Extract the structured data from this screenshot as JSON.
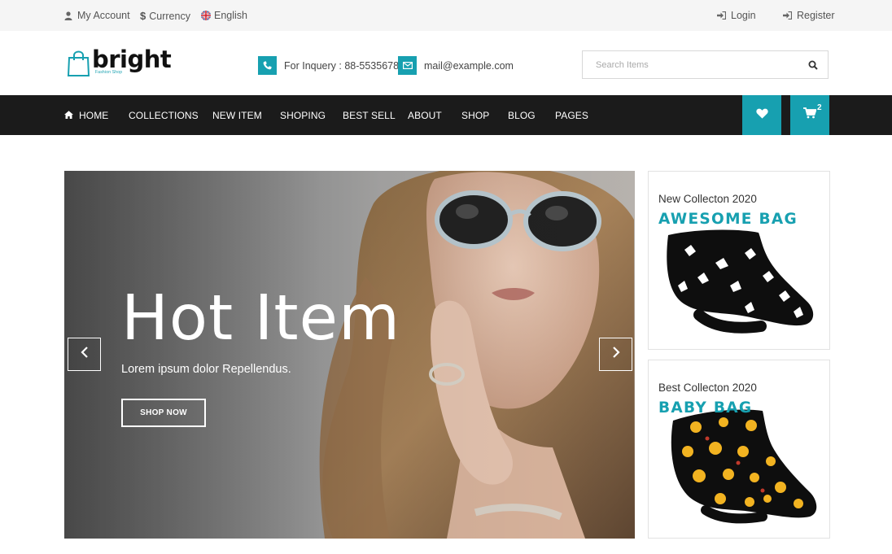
{
  "topbar": {
    "account": "My Account",
    "currency": "Currency",
    "language": "English",
    "login": "Login",
    "register": "Register"
  },
  "logo": {
    "word": "bright",
    "tagline": "Fashion Shop"
  },
  "contact": {
    "phone": "For Inquery : 88-5535678",
    "email": "mail@example.com"
  },
  "search": {
    "placeholder": "Search Items"
  },
  "nav": {
    "items": [
      "HOME",
      "COLLECTIONS",
      "NEW ITEM",
      "SHOPING",
      "BEST SELL",
      "ABOUT",
      "SHOP",
      "BLOG",
      "PAGES"
    ],
    "cart_count": "2"
  },
  "hero": {
    "title": "Hot Item",
    "subtitle": "Lorem ipsum dolor Repellendus.",
    "button": "SHOP NOW"
  },
  "banners": [
    {
      "caption": "New Collecton 2020",
      "heading": "AWESOME BAG"
    },
    {
      "caption": "Best Collecton 2020",
      "heading": "BABY BAG"
    }
  ],
  "colors": {
    "accent": "#17a0b0",
    "nav_bg": "#1b1b1b",
    "topbar_bg": "#f5f5f5"
  },
  "icons": [
    "user-icon",
    "dollar-icon",
    "uk-flag-icon",
    "login-icon",
    "register-icon",
    "phone-icon",
    "mail-icon",
    "search-icon",
    "home-icon",
    "heart-icon",
    "cart-icon",
    "chevron-left-icon",
    "chevron-right-icon"
  ]
}
